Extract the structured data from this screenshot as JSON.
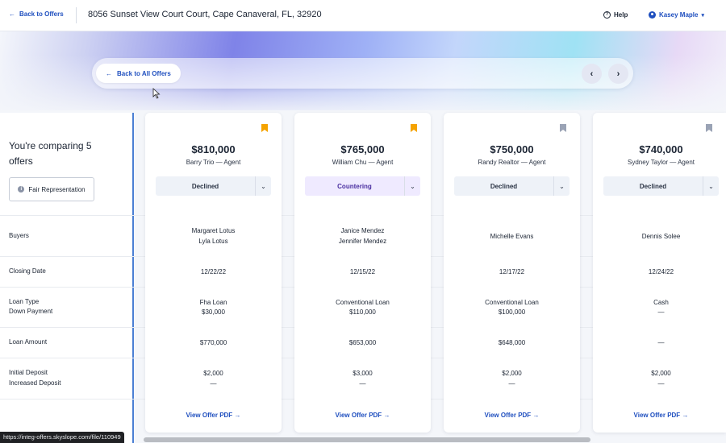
{
  "topbar": {
    "back_label": "Back to Offers",
    "address": "8056 Sunset View Court Court, Cape Canaveral, FL, 32920",
    "help_label": "Help",
    "user_name": "Kasey Maple"
  },
  "hero": {
    "back_all_label": "Back to All Offers",
    "prev_icon": "chevron-left-icon",
    "next_icon": "chevron-right-icon"
  },
  "left_panel": {
    "comparing_text": "You're comparing 5 offers",
    "fair_button_label": "Fair Representation",
    "rows": {
      "buyers": "Buyers",
      "closing": "Closing Date",
      "loan_type": "Loan Type",
      "down_payment": "Down Payment",
      "loan_amount": "Loan Amount",
      "initial_deposit": "Initial Deposit",
      "increased_deposit": "Increased Deposit"
    }
  },
  "offers": [
    {
      "price": "$810,000",
      "agent": "Barry Trio — Agent",
      "status": "Declined",
      "bookmarked": true,
      "buyers": [
        "Margaret Lotus",
        "Lyla Lotus"
      ],
      "closing_date": "12/22/22",
      "loan_type": "Fha Loan",
      "down_payment": "$30,000",
      "loan_amount": "$770,000",
      "initial_deposit": "$2,000",
      "increased_deposit": "—",
      "pdf_label": "View Offer PDF"
    },
    {
      "price": "$765,000",
      "agent": "William Chu — Agent",
      "status": "Countering",
      "bookmarked": true,
      "buyers": [
        "Janice Mendez",
        "Jennifer Mendez"
      ],
      "closing_date": "12/15/22",
      "loan_type": "Conventional Loan",
      "down_payment": "$110,000",
      "loan_amount": "$653,000",
      "initial_deposit": "$3,000",
      "increased_deposit": "—",
      "pdf_label": "View Offer PDF"
    },
    {
      "price": "$750,000",
      "agent": "Randy Realtor — Agent",
      "status": "Declined",
      "bookmarked": false,
      "buyers": [
        "Michelle Evans",
        ""
      ],
      "closing_date": "12/17/22",
      "loan_type": "Conventional Loan",
      "down_payment": "$100,000",
      "loan_amount": "$648,000",
      "initial_deposit": "$2,000",
      "increased_deposit": "—",
      "pdf_label": "View Offer PDF"
    },
    {
      "price": "$740,000",
      "agent": "Sydney Taylor — Agent",
      "status": "Declined",
      "bookmarked": false,
      "buyers": [
        "Dennis Solee",
        ""
      ],
      "closing_date": "12/24/22",
      "loan_type": "Cash",
      "down_payment": "—",
      "loan_amount": "—",
      "initial_deposit": "$2,000",
      "increased_deposit": "—",
      "pdf_label": "View Offer PDF"
    }
  ],
  "colors": {
    "accent": "#1f4fbf",
    "bookmark_active": "#f5a300",
    "bookmark_inactive": "#9aa3b5",
    "countering_text": "#4a2fa0"
  },
  "browser_status_url": "https://integ-offers.skyslope.com/file/110949"
}
